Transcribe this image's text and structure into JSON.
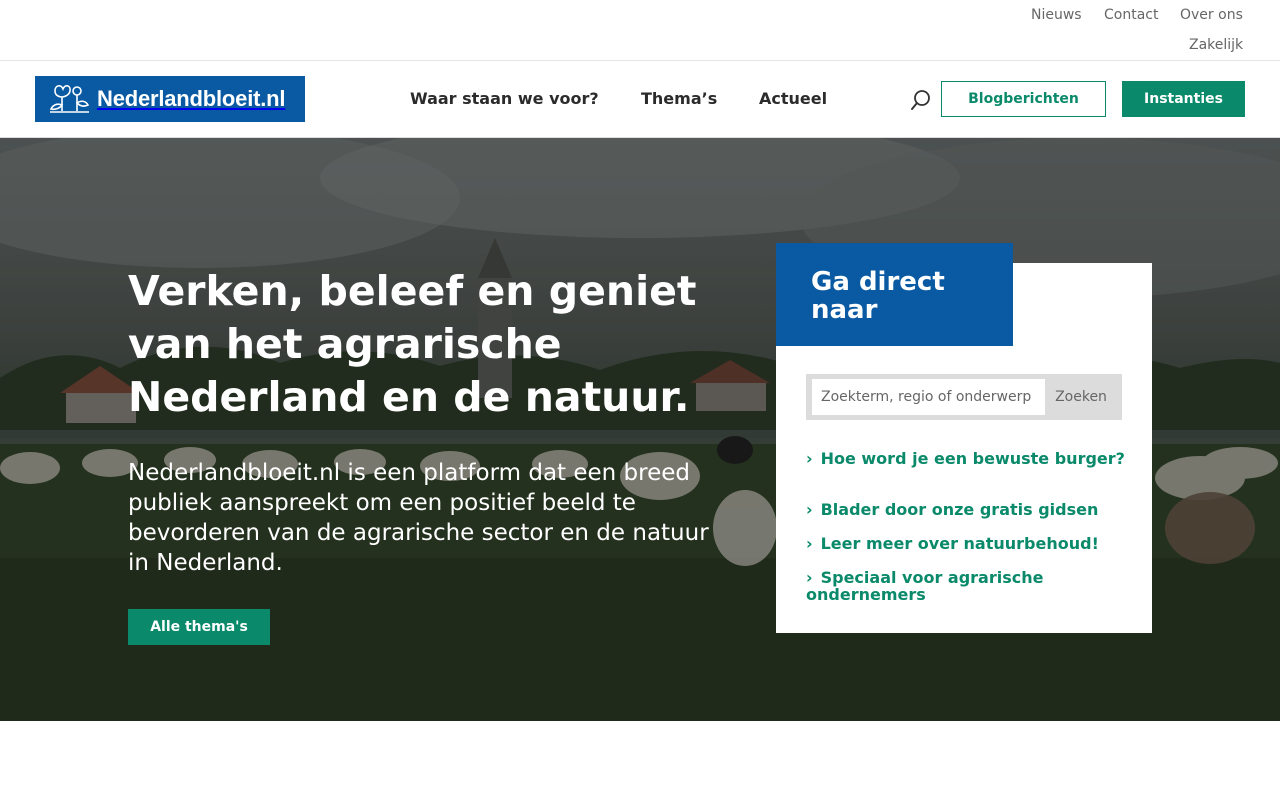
{
  "utility_nav": [
    "Nieuws",
    "Contact",
    "Over ons",
    "Zakelijk"
  ],
  "logo": {
    "text": "Nederlandbloeit.nl"
  },
  "main_nav": [
    "Waar staan we voor?",
    "Thema’s",
    "Actueel"
  ],
  "header_buttons": {
    "blog": "Blogberichten",
    "instanties": "Instanties"
  },
  "hero": {
    "title": "Verken, beleef en geniet van het agrarische Nederland en de natuur.",
    "text": "Nederlandbloeit.nl is een platform dat een breed publiek aanspreekt om een positief beeld te bevorderen van de agrarische sector en de natuur in Nederland.",
    "button": "Alle thema's"
  },
  "quick_panel": {
    "title": "Ga direct naar",
    "search_placeholder": "Zoekterm, regio of onderwerp",
    "search_button": "Zoeken",
    "links": [
      "Hoe word je een bewuste burger?",
      "Blader door onze gratis gidsen",
      "Leer meer over natuurbehoud!",
      "Speciaal voor agrarische ondernemers"
    ]
  },
  "colors": {
    "brand_blue": "#0a5aa3",
    "brand_green": "#0a8a6a"
  },
  "icons": {
    "search": "search-icon",
    "logo": "flower-logo-icon",
    "link_chevron": "chevron-right-icon"
  }
}
